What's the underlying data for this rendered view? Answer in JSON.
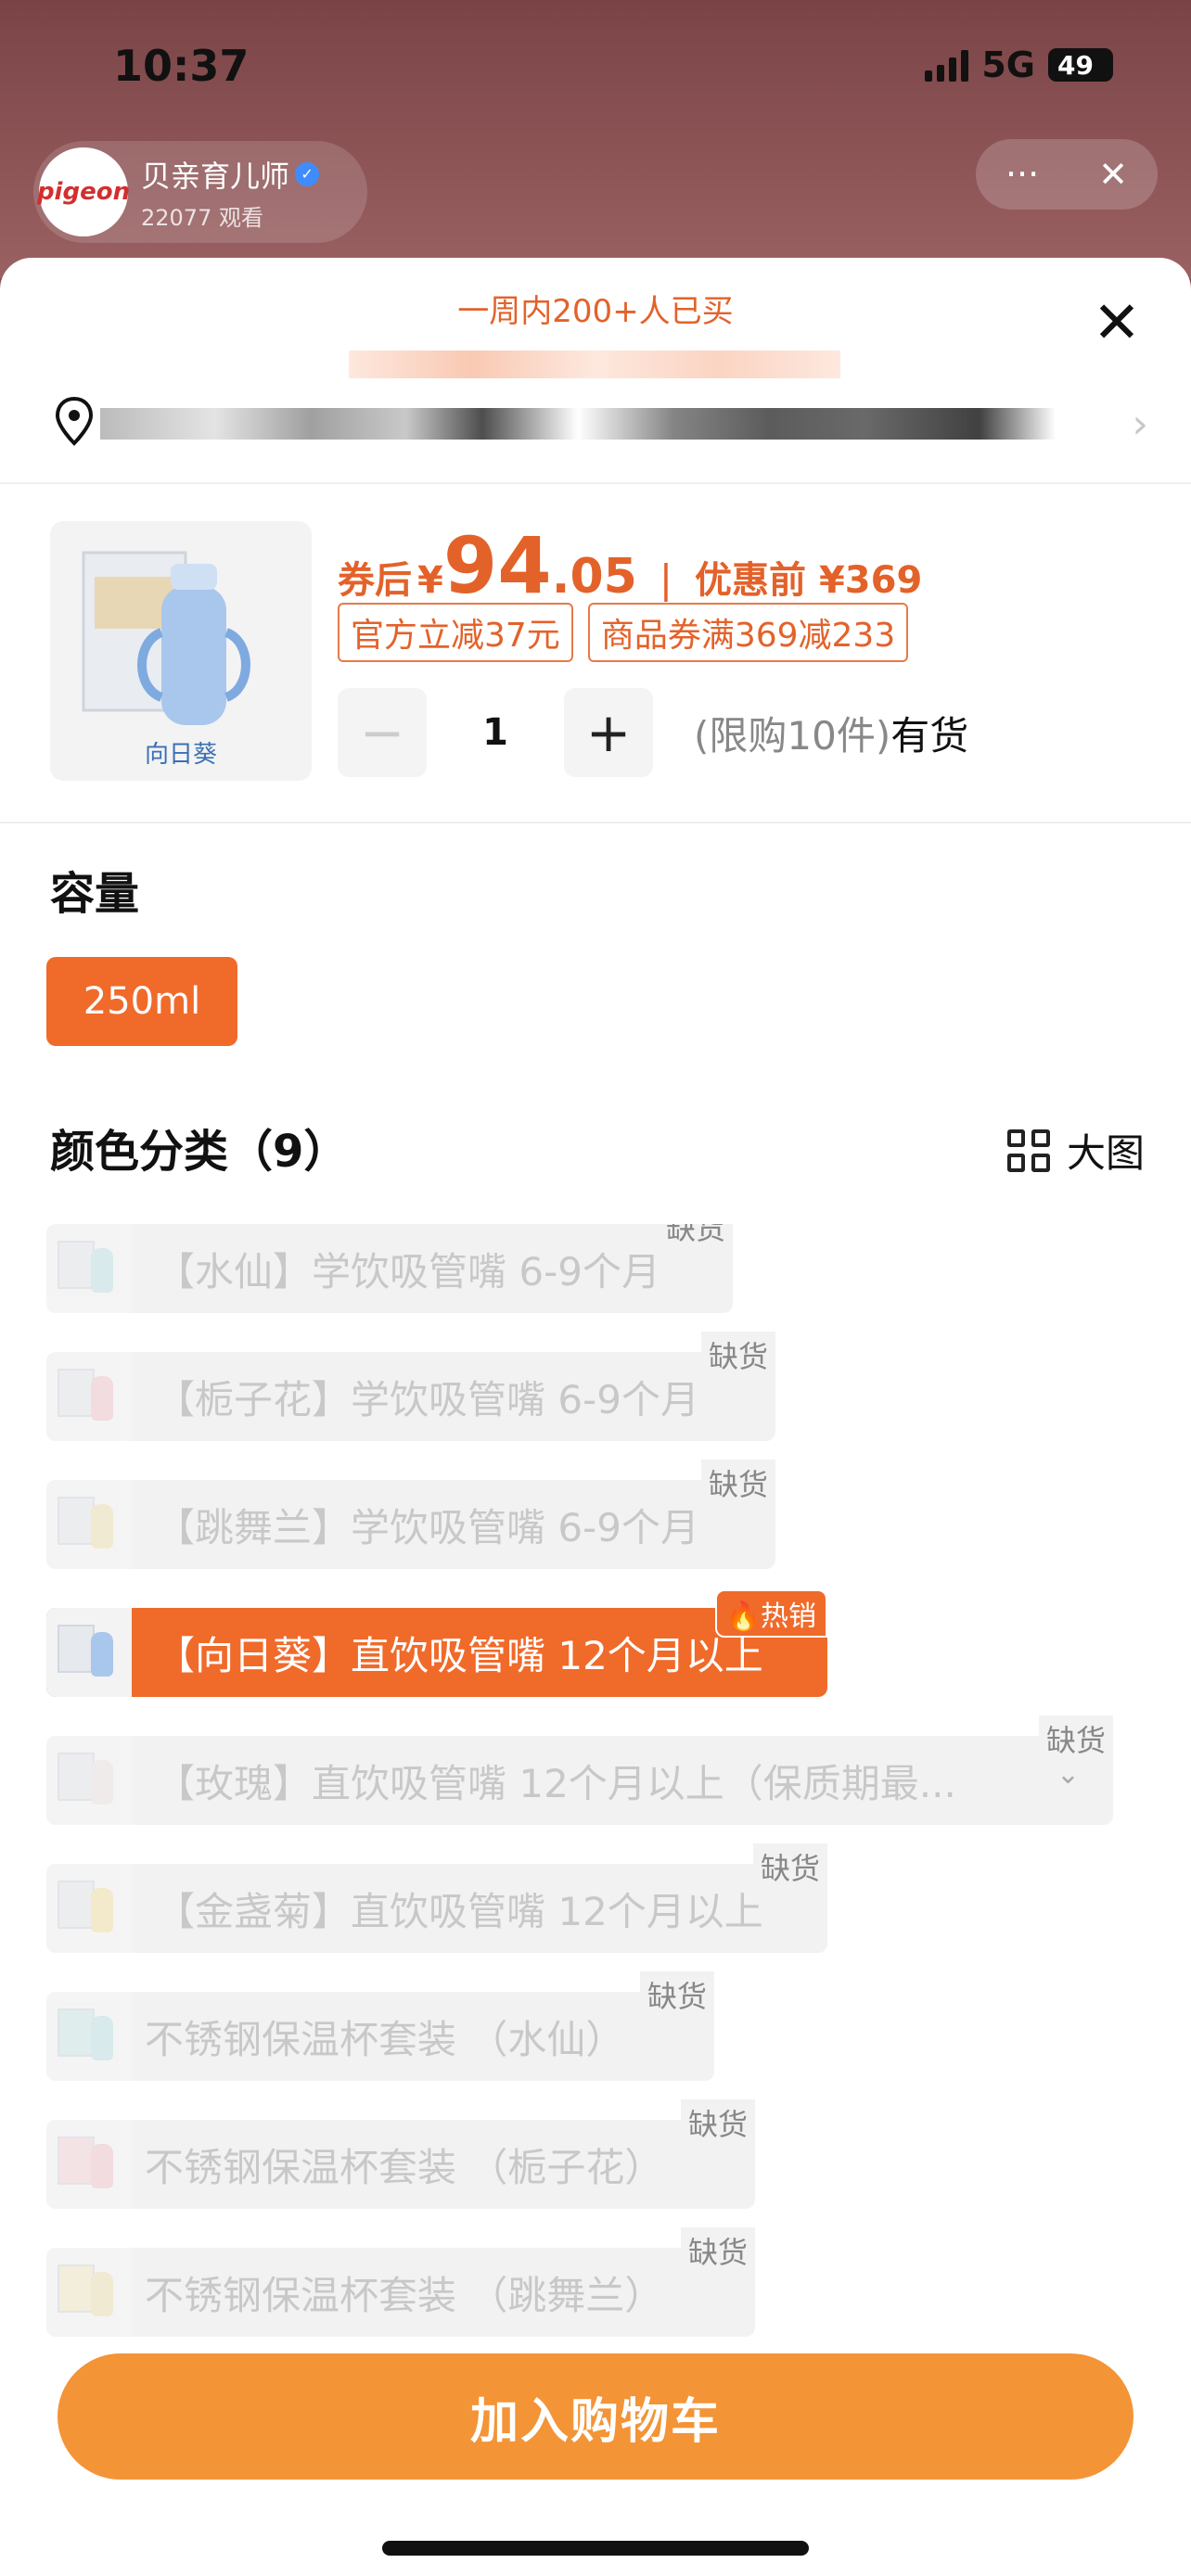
{
  "status_bar": {
    "time": "10:37",
    "network": "5G",
    "battery": "49"
  },
  "live_host": {
    "avatar_text": "pigeon",
    "name": "贝亲育儿师",
    "viewers": "22077 观看"
  },
  "sheet": {
    "social_proof": "一周内200+人已买",
    "close_glyph": "✕"
  },
  "product": {
    "thumb_caption": "向日葵",
    "after_coupon_label": "券后",
    "currency": "¥",
    "price_int": "94",
    "price_dec": ".05",
    "separator": "|",
    "before_label": "优惠前 ¥369",
    "coupons": [
      "官方立减37元",
      "商品券满369减233"
    ],
    "quantity": "1",
    "minus": "−",
    "plus": "+",
    "limit_note": "(限购10件)",
    "stock": "有货"
  },
  "capacity": {
    "title": "容量",
    "option": "250ml"
  },
  "colors": {
    "title": "颜色分类（9）",
    "bigview_label": "大图",
    "out_of_stock": "缺货",
    "hot_label": "热销",
    "options": [
      {
        "label": "【水仙】学饮吸管嘴 6-9个月",
        "status": "out"
      },
      {
        "label": "【栀子花】学饮吸管嘴 6-9个月",
        "status": "out"
      },
      {
        "label": "【跳舞兰】学饮吸管嘴 6-9个月",
        "status": "out"
      },
      {
        "label": "【向日葵】直饮吸管嘴 12个月以上",
        "status": "selected"
      },
      {
        "label": "【玫瑰】直饮吸管嘴 12个月以上（保质期最...",
        "status": "out"
      },
      {
        "label": "【金盏菊】直饮吸管嘴 12个月以上",
        "status": "out"
      },
      {
        "label": "不锈钢保温杯套装 （水仙）",
        "status": "out"
      },
      {
        "label": "不锈钢保温杯套装 （栀子花）",
        "status": "out"
      },
      {
        "label": "不锈钢保温杯套装 （跳舞兰）",
        "status": "out"
      }
    ]
  },
  "cart_button": "加入购物车",
  "theme": {
    "accent": "#f06a2a",
    "price": "#e3622a",
    "cart": "#f39437"
  }
}
